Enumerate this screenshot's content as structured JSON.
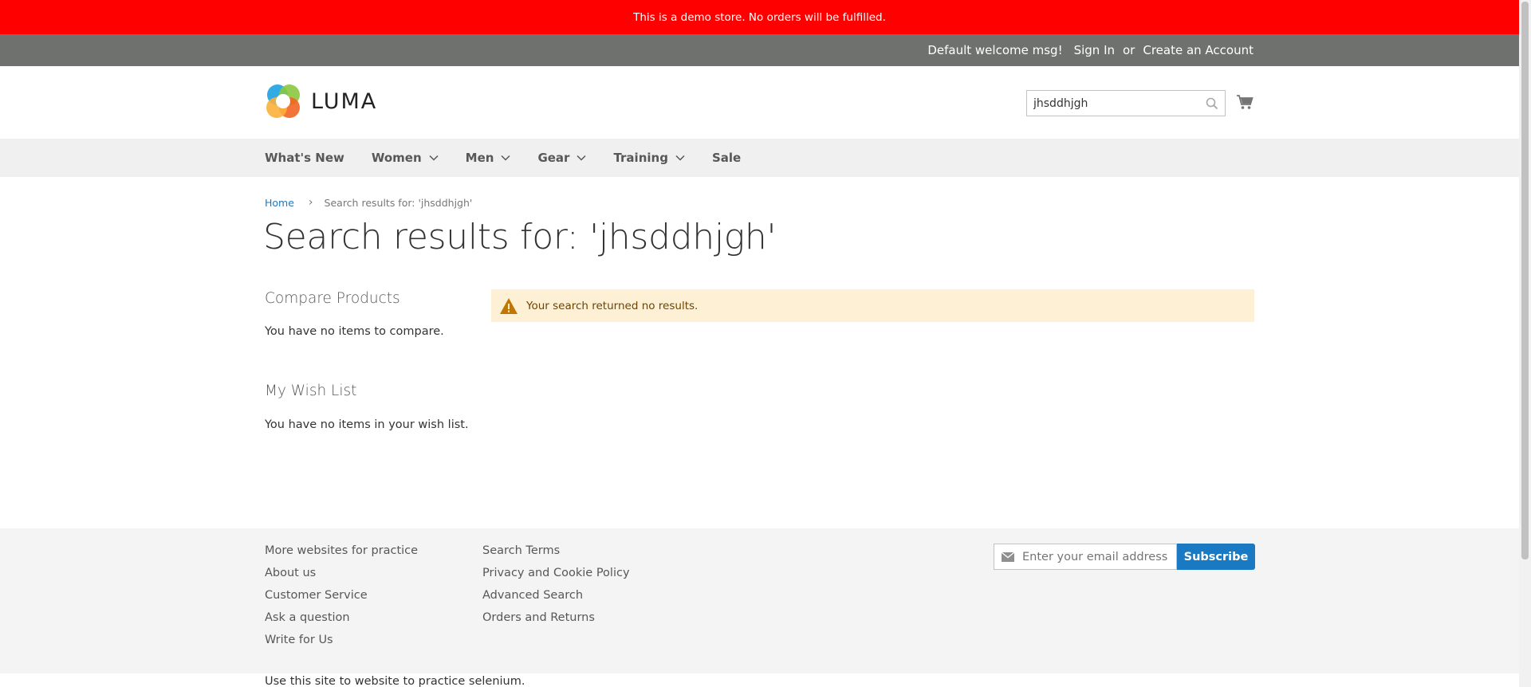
{
  "demo_notice": "This is a demo store. No orders will be fulfilled.",
  "panel": {
    "welcome": "Default welcome msg!",
    "sign_in": "Sign In",
    "or": "or",
    "create_account": "Create an Account"
  },
  "header": {
    "logo_text": "LUMA",
    "search_value": "jhsddhjgh",
    "search_icon": "search-icon",
    "cart_icon": "cart-icon"
  },
  "nav": {
    "items": [
      {
        "label": "What's New",
        "dropdown": false
      },
      {
        "label": "Women",
        "dropdown": true
      },
      {
        "label": "Men",
        "dropdown": true
      },
      {
        "label": "Gear",
        "dropdown": true
      },
      {
        "label": "Training",
        "dropdown": true
      },
      {
        "label": "Sale",
        "dropdown": false
      }
    ]
  },
  "breadcrumbs": {
    "home": "Home",
    "current": "Search results for: 'jhsddhjgh'"
  },
  "page_title": "Search results for: 'jhsddhjgh'",
  "sidebar": {
    "compare_title": "Compare Products",
    "compare_text": "You have no items to compare.",
    "wishlist_title": "My Wish List",
    "wishlist_text": "You have no items in your wish list."
  },
  "notice": {
    "message": "Your search returned no results.",
    "icon": "warning-icon"
  },
  "footer": {
    "col1": [
      "More websites for practice",
      "About us",
      "Customer Service",
      "Ask a question",
      "Write for Us"
    ],
    "col2": [
      "Search Terms",
      "Privacy and Cookie Policy",
      "Advanced Search",
      "Orders and Returns"
    ],
    "newsletter_placeholder": "Enter your email address",
    "subscribe": "Subscribe",
    "bottom_text": "Use this site to website to practice selenium."
  },
  "colors": {
    "demo_bar": "#ff0000",
    "panel": "#6e716e",
    "link": "#1979c3",
    "notice_bg": "#fdf0d5",
    "notice_text": "#6f4400"
  }
}
